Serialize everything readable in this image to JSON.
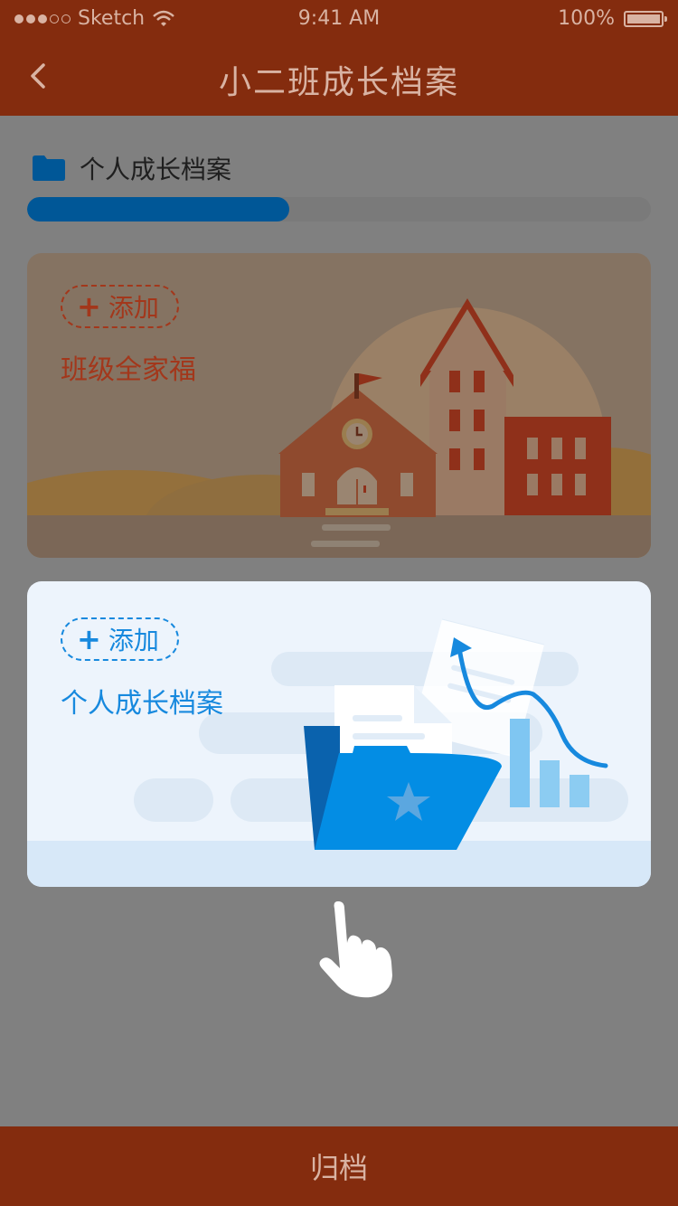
{
  "status_bar": {
    "carrier": "Sketch",
    "time": "9:41 AM",
    "battery": "100%",
    "icons": [
      "signal-dots-icon",
      "wifi-icon",
      "battery-icon"
    ]
  },
  "nav": {
    "title": "小二班成长档案",
    "back_icon": "chevron-left-icon"
  },
  "section": {
    "label": "个人成长档案",
    "icon": "folder-icon",
    "progress_fraction": 0.42
  },
  "cards": [
    {
      "add_label": "添加",
      "title": "班级全家福"
    },
    {
      "add_label": "添加",
      "title": "个人成长档案"
    }
  ],
  "bottom": {
    "label": "归档"
  },
  "colors": {
    "bar": "#842c0e",
    "bar_text": "#d9b3a3",
    "overlay": "#808080",
    "progress": "#005797",
    "card1_accent": "#a3371b",
    "card2_accent": "#1789de"
  }
}
